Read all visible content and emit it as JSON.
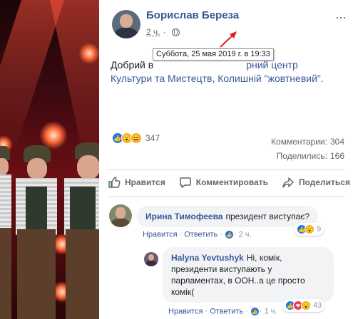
{
  "post": {
    "author": "Борислав Береза",
    "time": "2 ч.",
    "tooltip": "Суббота, 25 мая 2019 г. в 19:33",
    "text_plain_start": "Добрий в",
    "text_plain_mid": "...",
    "text_link_end": "рний центр",
    "text_link_line2": "Культури та Мистецтв, Колишній \"жовтневий\".",
    "reactions_count": "347",
    "comments_label": "Комментарии:",
    "comments_count": "304",
    "shares_label": "Поделились:",
    "shares_count": "166"
  },
  "actions": {
    "like": "Нравится",
    "comment": "Комментировать",
    "share": "Поделиться"
  },
  "comments": [
    {
      "name": "Ирина Тимофеева",
      "text": "президент виступає?",
      "like": "Нравится",
      "reply": "Ответить",
      "time": "2 ч.",
      "reactions": "9"
    },
    {
      "name": "Halyna Yevtushyk",
      "text_line1": "Ні, комік,",
      "text_line2": "президенти виступають у",
      "text_line3": "парламентах, в ООН..а це просто",
      "text_line4": "комік(",
      "like": "Нравится",
      "reply": "Ответить",
      "time": "1 ч.",
      "reactions": "43"
    }
  ],
  "icons": {
    "like": "thumbs-up-icon",
    "comment": "speech-bubble-icon",
    "share": "share-arrow-icon",
    "privacy": "globe-icon",
    "menu": "more-horizontal-icon"
  },
  "colors": {
    "link": "#385898",
    "author": "#365899",
    "muted": "#606770",
    "like_blue": "#1877f2",
    "wow_yellow": "#f7b125",
    "love_red": "#f33e58",
    "annotation_arrow": "#e02020"
  }
}
